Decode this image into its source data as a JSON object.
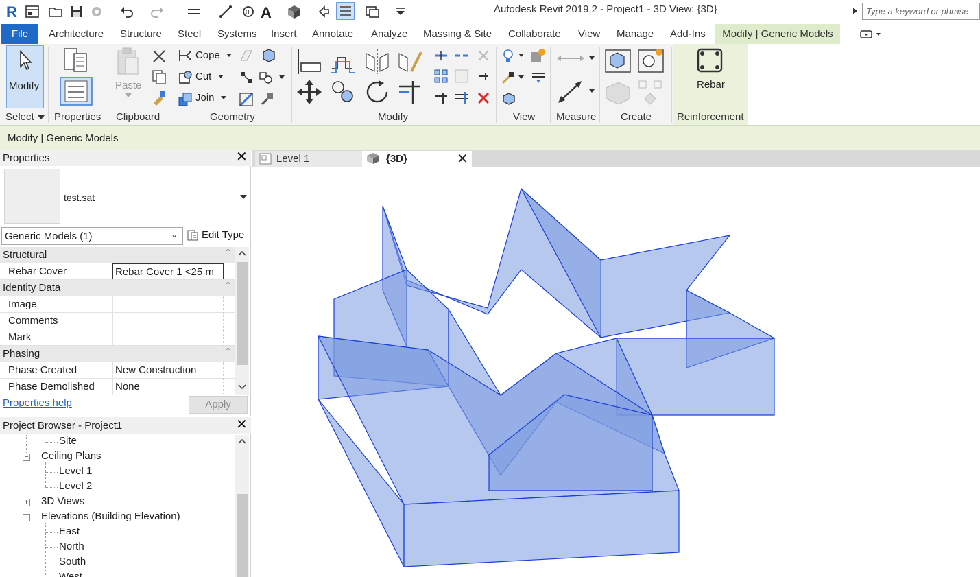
{
  "app": {
    "title": "Autodesk Revit 2019.2 - Project1 - 3D View: {3D}",
    "search_placeholder": "Type a keyword or phrase"
  },
  "menu": {
    "file": "File",
    "tabs": [
      "Architecture",
      "Structure",
      "Steel",
      "Systems",
      "Insert",
      "Annotate",
      "Analyze",
      "Massing & Site",
      "Collaborate",
      "View",
      "Manage",
      "Add-Ins"
    ],
    "active": "Modify | Generic Models"
  },
  "ribbon": {
    "modify_label": "Modify",
    "paste_label": "Paste",
    "cope_label": "Cope",
    "cut_label": "Cut",
    "join_label": "Join",
    "rebar_label": "Rebar",
    "panels": {
      "select": "Select",
      "properties": "Properties",
      "clipboard": "Clipboard",
      "geometry": "Geometry",
      "modify": "Modify",
      "view": "View",
      "measure": "Measure",
      "create": "Create",
      "reinforcement": "Reinforcement"
    }
  },
  "context_bar": {
    "title": "Modify | Generic Models"
  },
  "properties": {
    "title": "Properties",
    "type_name": "test.sat",
    "filter": "Generic Models (1)",
    "edit_type": "Edit Type",
    "groups": {
      "structural": "Structural",
      "identity": "Identity Data",
      "phasing": "Phasing"
    },
    "rows": {
      "rebar_cover_key": "Rebar Cover",
      "rebar_cover_val": "Rebar Cover 1 <25 m",
      "image_key": "Image",
      "comments_key": "Comments",
      "mark_key": "Mark",
      "phase_created_key": "Phase Created",
      "phase_created_val": "New Construction",
      "phase_demolished_key": "Phase Demolished",
      "phase_demolished_val": "None"
    },
    "help_link": "Properties help",
    "apply": "Apply"
  },
  "browser": {
    "title": "Project Browser - Project1",
    "items": {
      "site": "Site",
      "ceiling_plans": "Ceiling Plans",
      "level1": "Level 1",
      "level2": "Level 2",
      "views3d": "3D Views",
      "elevations": "Elevations (Building Elevation)",
      "east": "East",
      "north": "North",
      "south": "South",
      "west": "West"
    }
  },
  "views": {
    "level1_tab": "Level 1",
    "3d_tab": "{3D}"
  },
  "model_color": "#7b9be0",
  "edge_color": "#1a3fd6"
}
